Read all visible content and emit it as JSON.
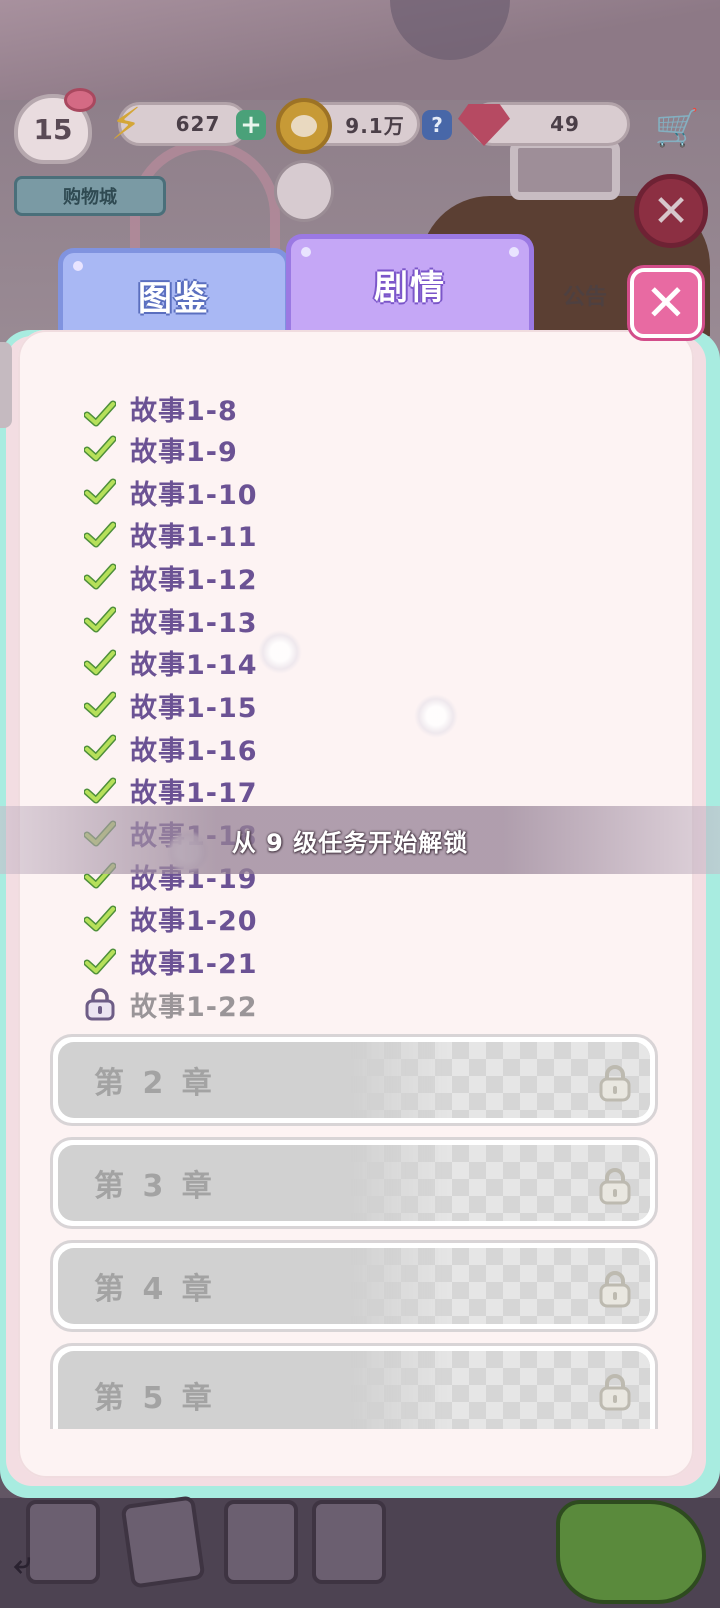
{
  "hud": {
    "level": "15",
    "energy": "627",
    "coins": "9.1万",
    "gems": "49",
    "shopping_mall": "购物城",
    "notice": "公告"
  },
  "tabs": [
    {
      "label": "图鉴",
      "active": false
    },
    {
      "label": "剧情",
      "active": true
    }
  ],
  "stories": [
    {
      "label": "故事1-8",
      "status": "done"
    },
    {
      "label": "故事1-9",
      "status": "done"
    },
    {
      "label": "故事1-10",
      "status": "done"
    },
    {
      "label": "故事1-11",
      "status": "done"
    },
    {
      "label": "故事1-12",
      "status": "done"
    },
    {
      "label": "故事1-13",
      "status": "done"
    },
    {
      "label": "故事1-14",
      "status": "done"
    },
    {
      "label": "故事1-15",
      "status": "done"
    },
    {
      "label": "故事1-16",
      "status": "done"
    },
    {
      "label": "故事1-17",
      "status": "done"
    },
    {
      "label": "故事1-18",
      "status": "done"
    },
    {
      "label": "故事1-19",
      "status": "done"
    },
    {
      "label": "故事1-20",
      "status": "done"
    },
    {
      "label": "故事1-21",
      "status": "done"
    },
    {
      "label": "故事1-22",
      "status": "locked"
    }
  ],
  "chapters": [
    {
      "label": "第 2 章",
      "locked": true
    },
    {
      "label": "第 3 章",
      "locked": true
    },
    {
      "label": "第 4 章",
      "locked": true
    },
    {
      "label": "第 5 章",
      "locked": true
    }
  ],
  "toast": "从 9 级任务开始解锁",
  "colors": {
    "panel_border": "#a8ece0",
    "story_text": "#6b5294",
    "locked_text": "#9a9598",
    "close_button": "#e86aa2",
    "active_tab": "#c5a7f6",
    "inactive_tab": "#a9b8f4"
  }
}
